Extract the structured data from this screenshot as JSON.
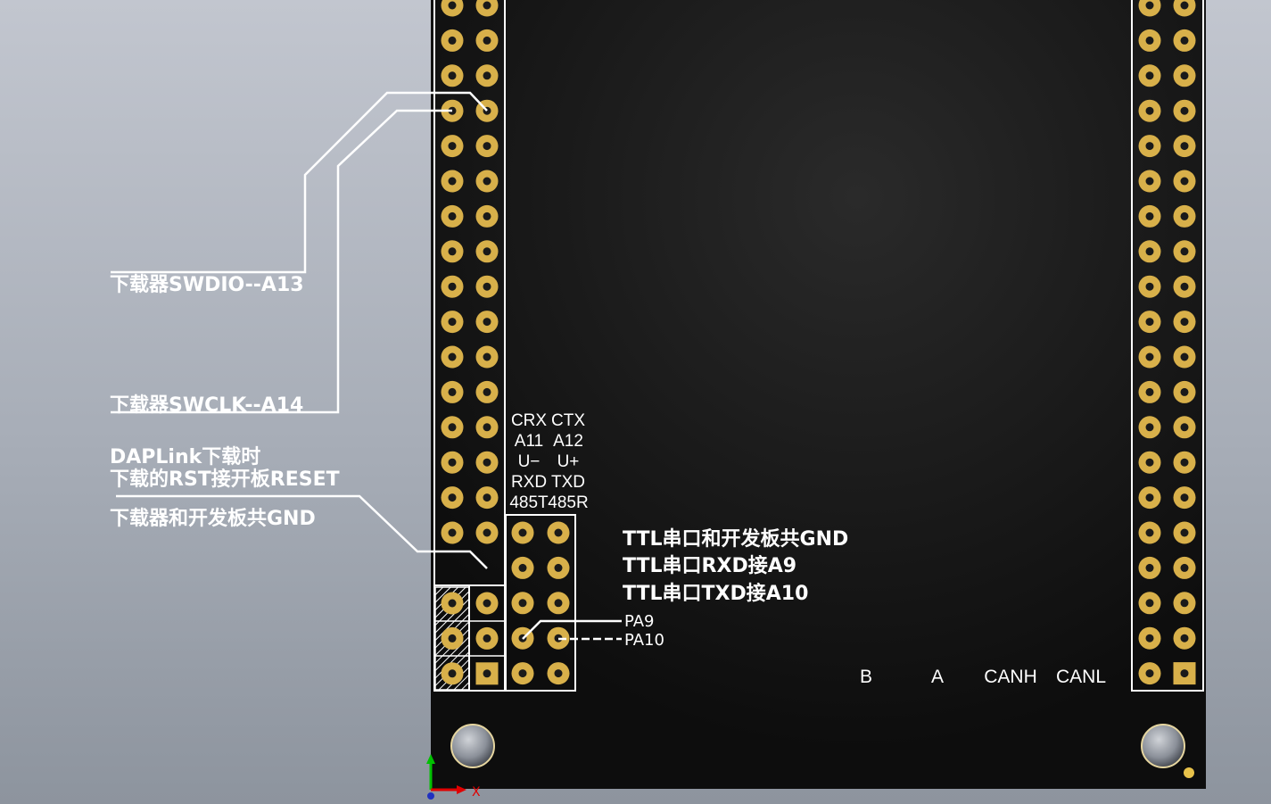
{
  "pcb": {
    "silkscreen_color": "#ffffff",
    "board_color": "#111111",
    "pad_color": "#d8b04a",
    "left_header_rows": 16,
    "right_header_rows": 20,
    "connector_labels": [
      {
        "line1": "CRX",
        "line2": "A11",
        "line3": "U−",
        "line4": "RXD",
        "line5": "485T"
      },
      {
        "line1": "CTX",
        "line2": "A12",
        "line3": "U+",
        "line4": "TXD",
        "line5": "485R"
      }
    ],
    "bottom_labels": [
      "B",
      "A",
      "CANH",
      "CANL"
    ]
  },
  "annotations": {
    "swdio": "下载器SWDIO--A13",
    "swclk": "下载器SWCLK--A14",
    "daplink_line1": "DAPLink下载时",
    "daplink_line2": "下载的RST接开板RESET",
    "gnd": "下载器和开发板共GND",
    "ttl_gnd": "TTL串口和开发板共GND",
    "ttl_rxd": "TTL串口RXD接A9",
    "ttl_txd": "TTL串口TXD接A10",
    "pa9": "PA9",
    "pa10": "PA10"
  },
  "axes": {
    "x_label": "X"
  }
}
